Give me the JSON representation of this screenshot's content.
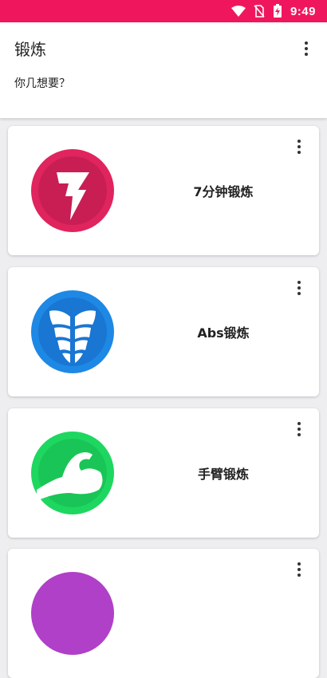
{
  "status_bar": {
    "time": "9:49",
    "icons": [
      "wifi-icon",
      "no-sim-icon",
      "battery-charging-icon"
    ]
  },
  "header": {
    "title": "锻炼",
    "subtitle": "你几想要？",
    "menu_icon": "more-vert-icon"
  },
  "workouts": [
    {
      "label": "7分钟锻炼",
      "icon": "lightning-icon",
      "color": "#e0245e"
    },
    {
      "label": "Abs锻炼",
      "icon": "abs-icon",
      "color": "#1e88e5"
    },
    {
      "label": "手臂锻炼",
      "icon": "bicep-icon",
      "color": "#1ed760"
    },
    {
      "label": "",
      "icon": "",
      "color": "#b040c8"
    }
  ],
  "colors": {
    "accent": "#f0165e",
    "background": "#eeeef0"
  }
}
